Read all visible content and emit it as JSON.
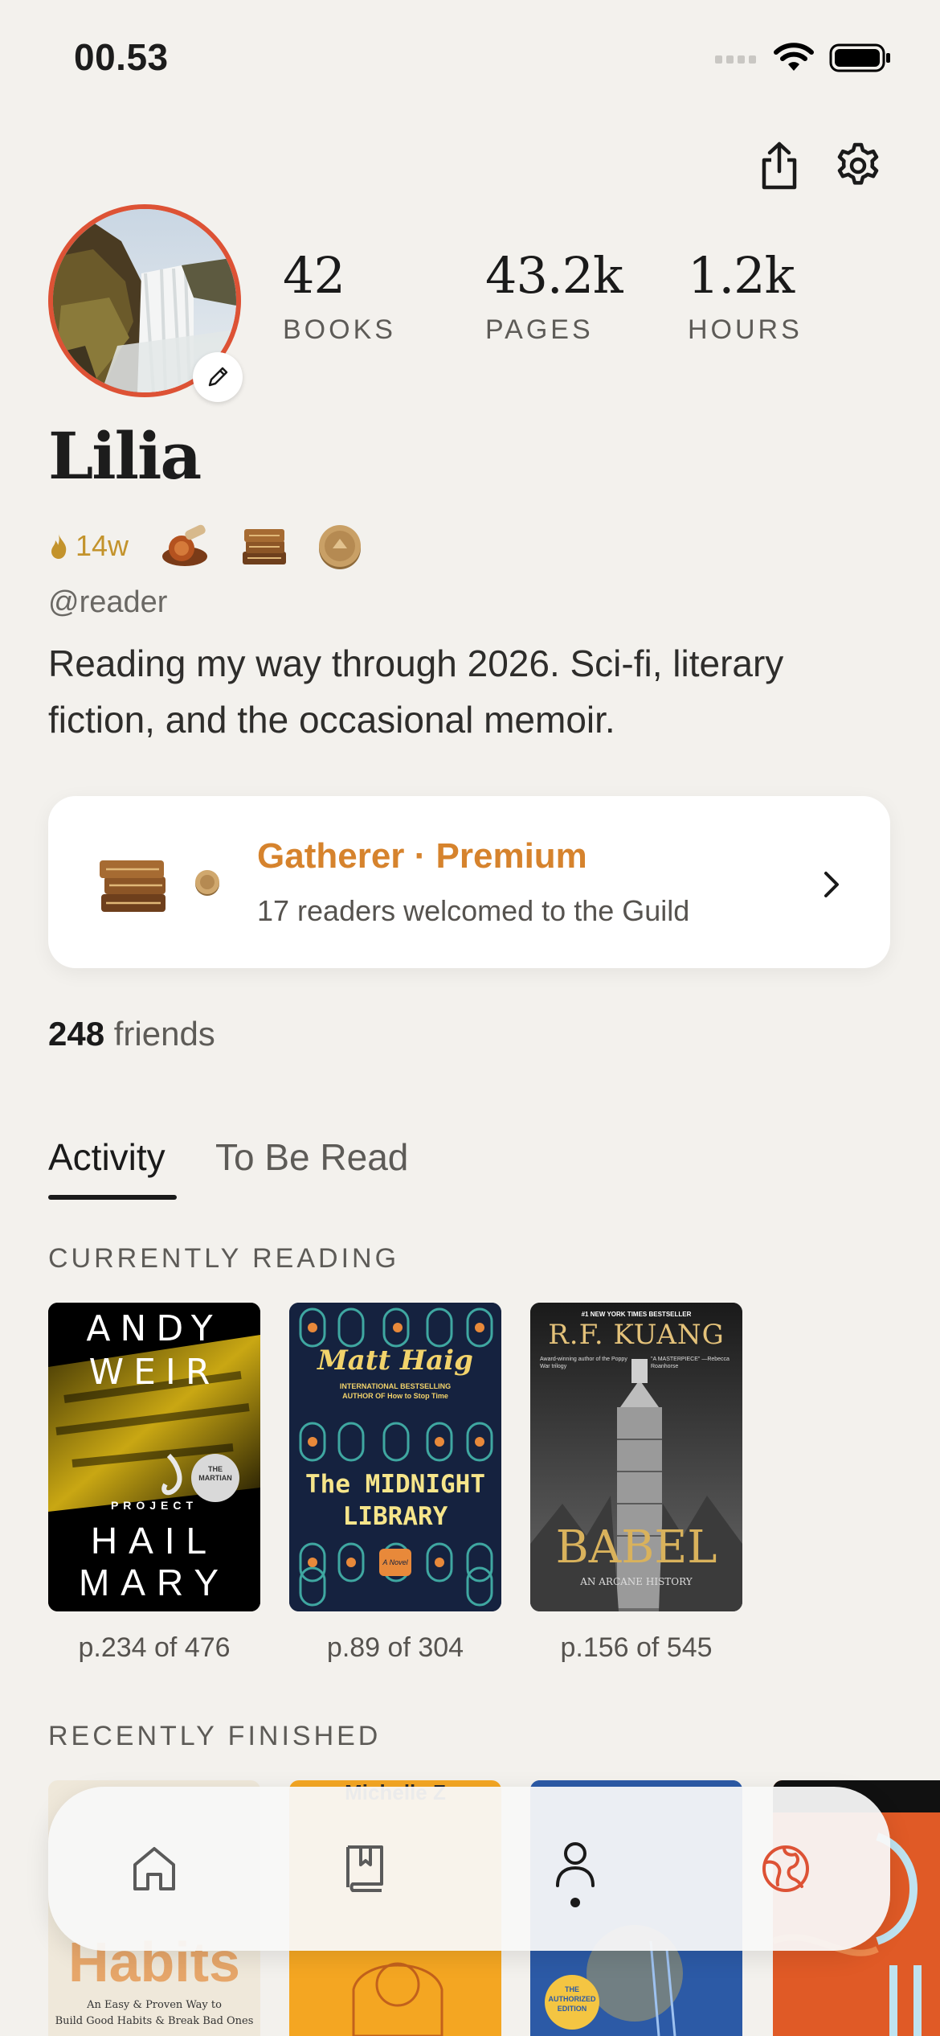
{
  "status_bar": {
    "time": "00.53"
  },
  "profile": {
    "stats": [
      {
        "value": "42",
        "label": "BOOKS"
      },
      {
        "value": "43.2k",
        "label": "PAGES"
      },
      {
        "value": "1.2k",
        "label": "HOURS"
      }
    ],
    "name": "Lilia",
    "streak": "14w",
    "handle": "@reader",
    "bio": "Reading my way through 2026. Sci-fi, literary fiction, and the occasional memoir."
  },
  "guild_card": {
    "title": "Gatherer · Premium",
    "subtitle": "17 readers welcomed to the Guild"
  },
  "friends": {
    "count": "248",
    "label": "friends"
  },
  "tabs": [
    {
      "label": "Activity",
      "active": true
    },
    {
      "label": "To Be Read",
      "active": false
    }
  ],
  "currently_reading": {
    "heading": "CURRENTLY READING",
    "books": [
      {
        "cover_lines": [
          "ANDY",
          "WEIR",
          "PROJECT",
          "HAIL",
          "MARY"
        ],
        "badge": [
          "THE",
          "MARTIAN"
        ],
        "progress": "p.234 of 476"
      },
      {
        "cover_lines": [
          "Matt Haig",
          "INTERNATIONAL BESTSELLING",
          "AUTHOR OF How to Stop Time",
          "The MIDNIGHT",
          "LIBRARY",
          "A Novel"
        ],
        "progress": "p.89 of 304"
      },
      {
        "cover_lines": [
          "#1 NEW YORK TIMES BESTSELLER",
          "R.F. KUANG",
          "Award-winning author of the Poppy War trilogy",
          "\"A MASTERPIECE\" —Rebecca Roanhorse",
          "BABEL",
          "AN ARCANE HISTORY"
        ],
        "progress": "p.156 of 545"
      }
    ]
  },
  "recently_finished": {
    "heading": "RECENTLY FINISHED",
    "books": [
      {
        "cover_lines": [
          "Habits",
          "An Easy & Proven Way to",
          "Build Good Habits & Break Bad Ones"
        ]
      },
      {
        "cover_lines": [
          "Michelle Z"
        ]
      },
      {
        "cover_lines": [
          "THE",
          "AUTHORIZED",
          "EDITION"
        ]
      },
      {
        "cover_lines": []
      }
    ]
  },
  "icons": {
    "share": "share-icon",
    "settings": "gear-icon",
    "edit": "pencil-icon",
    "home": "home-icon",
    "library": "bookmark-book-icon",
    "profile": "person-icon",
    "explore": "globe-icon"
  },
  "colors": {
    "accent": "#dd5235",
    "gold": "#d6832d",
    "streak": "#c3932c",
    "background": "#f3f1ed"
  }
}
